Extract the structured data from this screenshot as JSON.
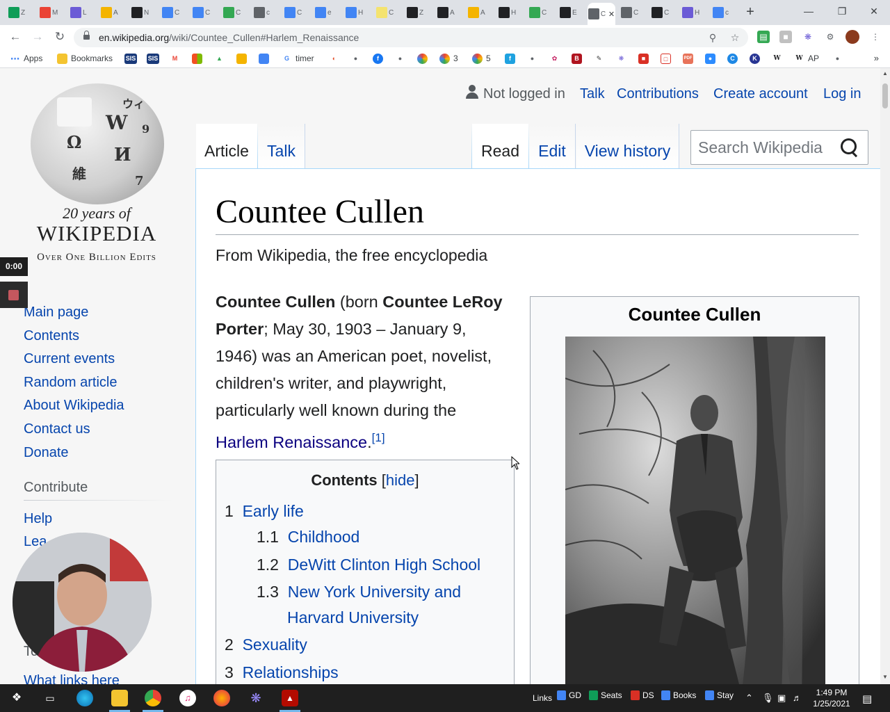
{
  "browser": {
    "tabs": [
      {
        "letter": "Z",
        "color": "#0f9d58"
      },
      {
        "letter": "M",
        "color": "#ea4335"
      },
      {
        "letter": "L",
        "color": "#6b5bd6"
      },
      {
        "letter": "A",
        "color": "#f4b400"
      },
      {
        "letter": "N",
        "color": "#202124"
      },
      {
        "letter": "C",
        "color": "#4285f4"
      },
      {
        "letter": "C",
        "color": "#4285f4"
      },
      {
        "letter": "C",
        "color": "#34a853"
      },
      {
        "letter": "c",
        "color": "#5f6368"
      },
      {
        "letter": "C",
        "color": "#4285f4"
      },
      {
        "letter": "e",
        "color": "#4285f4"
      },
      {
        "letter": "H",
        "color": "#4285f4"
      },
      {
        "letter": "C",
        "color": "#f4e36f"
      },
      {
        "letter": "Z",
        "color": "#202124"
      },
      {
        "letter": "A",
        "color": "#202124"
      },
      {
        "letter": "A",
        "color": "#f4b400"
      },
      {
        "letter": "H",
        "color": "#202124"
      },
      {
        "letter": "C",
        "color": "#34a853"
      },
      {
        "letter": "E",
        "color": "#202124"
      },
      {
        "letter": "C",
        "color": "#5f6368",
        "active": true
      },
      {
        "letter": "C",
        "color": "#5f6368"
      },
      {
        "letter": "C",
        "color": "#202124"
      },
      {
        "letter": "H",
        "color": "#6b5bd6"
      },
      {
        "letter": "c",
        "color": "#4285f4"
      }
    ],
    "url_host": "en.wikipedia.org",
    "url_path": "/wiki/Countee_Cullen#Harlem_Renaissance",
    "bookmarks": {
      "apps": "Apps",
      "bookmarks": "Bookmarks",
      "sis1": "SIS",
      "sis2": "SIS",
      "timer": "timer",
      "n3": "3",
      "n5": "5",
      "ap": "AP"
    }
  },
  "wiki": {
    "logo": {
      "line1": "20 years of",
      "line2": "WIKIPEDIA",
      "line3": "Over One Billion Edits"
    },
    "nav": [
      "Main page",
      "Contents",
      "Current events",
      "Random article",
      "About Wikipedia",
      "Contact us",
      "Donate"
    ],
    "contribute_heading": "Contribute",
    "contribute": [
      "Help",
      "Lea"
    ],
    "tools_heading": "To",
    "what_links": "What links here",
    "personal": {
      "not_logged_in": "Not logged in",
      "talk": "Talk",
      "contributions": "Contributions",
      "create_account": "Create account",
      "log_in": "Log in"
    },
    "tabs": {
      "article": "Article",
      "talk": "Talk",
      "read": "Read",
      "edit": "Edit",
      "history": "View history"
    },
    "search_placeholder": "Search Wikipedia",
    "title": "Countee Cullen",
    "tagline": "From Wikipedia, the free encyclopedia",
    "lead": {
      "name": "Countee Cullen",
      "born_prefix": " (born ",
      "born_name": "Countee LeRoy Porter",
      "text": "; May 30, 1903 – January 9, 1946) was an American poet, novelist, children's writer, and playwright, particularly well known during the ",
      "link": "Harlem Renaissance",
      "period": ".",
      "ref": "[1]"
    },
    "toc": {
      "title": "Contents",
      "hide": "hide",
      "items": [
        {
          "num": "1",
          "label": "Early life"
        },
        {
          "num": "1.1",
          "label": "Childhood"
        },
        {
          "num": "1.2",
          "label": "DeWitt Clinton High School"
        },
        {
          "num": "1.3",
          "label": "New York University and"
        },
        {
          "num": "",
          "label": "Harvard University"
        },
        {
          "num": "2",
          "label": "Sexuality"
        },
        {
          "num": "3",
          "label": "Relationships"
        }
      ]
    },
    "infobox_title": "Countee Cullen"
  },
  "overlay": {
    "timer": "0:00"
  },
  "taskbar": {
    "links_label": "Links",
    "links": [
      "GD",
      "Seats",
      "DS",
      "Books",
      "Stay"
    ],
    "time": "1:49 PM",
    "date": "1/25/2021"
  }
}
